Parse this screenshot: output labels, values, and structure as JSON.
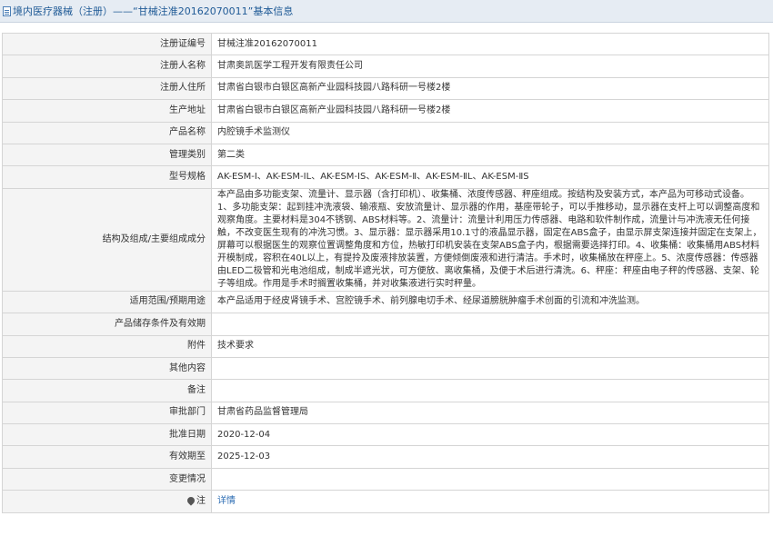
{
  "header": {
    "icon": "document-icon",
    "title": "境内医疗器械（注册）——“甘械注准20162070011”基本信息"
  },
  "rows": [
    {
      "label": "注册证编号",
      "value": "甘械注准20162070011"
    },
    {
      "label": "注册人名称",
      "value": "甘肃奥凯医学工程开发有限责任公司"
    },
    {
      "label": "注册人住所",
      "value": "甘肃省白银市白银区高新产业园科技园八路科研一号楼2楼"
    },
    {
      "label": "生产地址",
      "value": "甘肃省白银市白银区高新产业园科技园八路科研一号楼2楼"
    },
    {
      "label": "产品名称",
      "value": "内腔镜手术监测仪"
    },
    {
      "label": "管理类别",
      "value": "第二类"
    },
    {
      "label": "型号规格",
      "value": "AK-ESM-Ⅰ、AK-ESM-ⅠL、AK-ESM-ⅠS、AK-ESM-Ⅱ、AK-ESM-ⅡL、AK-ESM-ⅡS"
    },
    {
      "label": "结构及组成/主要组成成分",
      "value": "本产品由多功能支架、流量计、显示器（含打印机）、收集桶、浓度传感器、秤座组成。按结构及安装方式，本产品为可移动式设备。1、多功能支架：起到挂冲洗液袋、输液瓶、安放流量计、显示器的作用，基座带轮子，可以手推移动，显示器在支杆上可以调整高度和观察角度。主要材料是304不锈钢、ABS材料等。2、流量计：流量计利用压力传感器、电路和软件制作成，流量计与冲洗液无任何接触，不改变医生现有的冲洗习惯。3、显示器：显示器采用10.1寸的液晶显示器，固定在ABS盒子，由显示屏支架连接并固定在支架上，屏幕可以根据医生的观察位置调整角度和方位，热敏打印机安装在支架ABS盒子内，根据需要选择打印。4、收集桶：收集桶用ABS材料开模制成，容积在40L以上，有提拎及废液排放装置，方便倾倒废液和进行清洁。手术时，收集桶放在秤座上。5、浓度传感器：传感器由LED二极管和光电池组成，制成半遮光状，可方便放、离收集桶，及便于术后进行清洗。6、秤座：秤座由电子秤的传感器、支架、轮子等组成。作用是手术时搁置收集桶，并对收集液进行实时秤量。"
    },
    {
      "label": "适用范围/预期用途",
      "value": "本产品适用于经皮肾镜手术、宫腔镜手术、前列腺电切手术、经尿道膀胱肿瘤手术创面的引流和冲洗监测。"
    },
    {
      "label": "产品储存条件及有效期",
      "value": ""
    },
    {
      "label": "附件",
      "value": "技术要求"
    },
    {
      "label": "其他内容",
      "value": ""
    },
    {
      "label": "备注",
      "value": ""
    },
    {
      "label": "审批部门",
      "value": "甘肃省药品监督管理局"
    },
    {
      "label": "批准日期",
      "value": "2020-12-04"
    },
    {
      "label": "有效期至",
      "value": "2025-12-03"
    },
    {
      "label": "变更情况",
      "value": ""
    }
  ],
  "note_row": {
    "icon": "pin-icon",
    "label": "注",
    "link_text": "详情"
  }
}
